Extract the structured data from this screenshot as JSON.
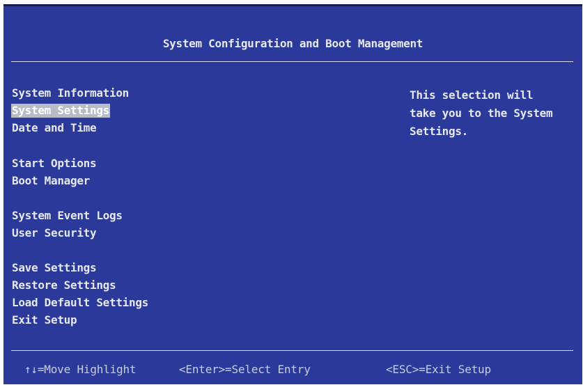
{
  "title": "System Configuration and Boot Management",
  "menu": {
    "items": [
      {
        "label": "System Information",
        "selected": false
      },
      {
        "label": "System Settings",
        "selected": true
      },
      {
        "label": "Date and Time",
        "selected": false
      },
      {
        "label": "Start Options",
        "selected": false
      },
      {
        "label": "Boot Manager",
        "selected": false
      },
      {
        "label": "System Event Logs",
        "selected": false
      },
      {
        "label": "User Security",
        "selected": false
      },
      {
        "label": "Save Settings",
        "selected": false
      },
      {
        "label": "Restore Settings",
        "selected": false
      },
      {
        "label": "Load Default Settings",
        "selected": false
      },
      {
        "label": "Exit Setup",
        "selected": false
      }
    ]
  },
  "help": {
    "lines": [
      "This selection will",
      "take you to the System",
      "Settings."
    ]
  },
  "footer": {
    "move": "↑↓=Move Highlight",
    "select": "<Enter>=Select Entry",
    "exit": "<ESC>=Exit Setup"
  },
  "colors": {
    "background": "#2b3a9a",
    "text": "#e6e8f0",
    "highlight": "#b8bcc8"
  }
}
